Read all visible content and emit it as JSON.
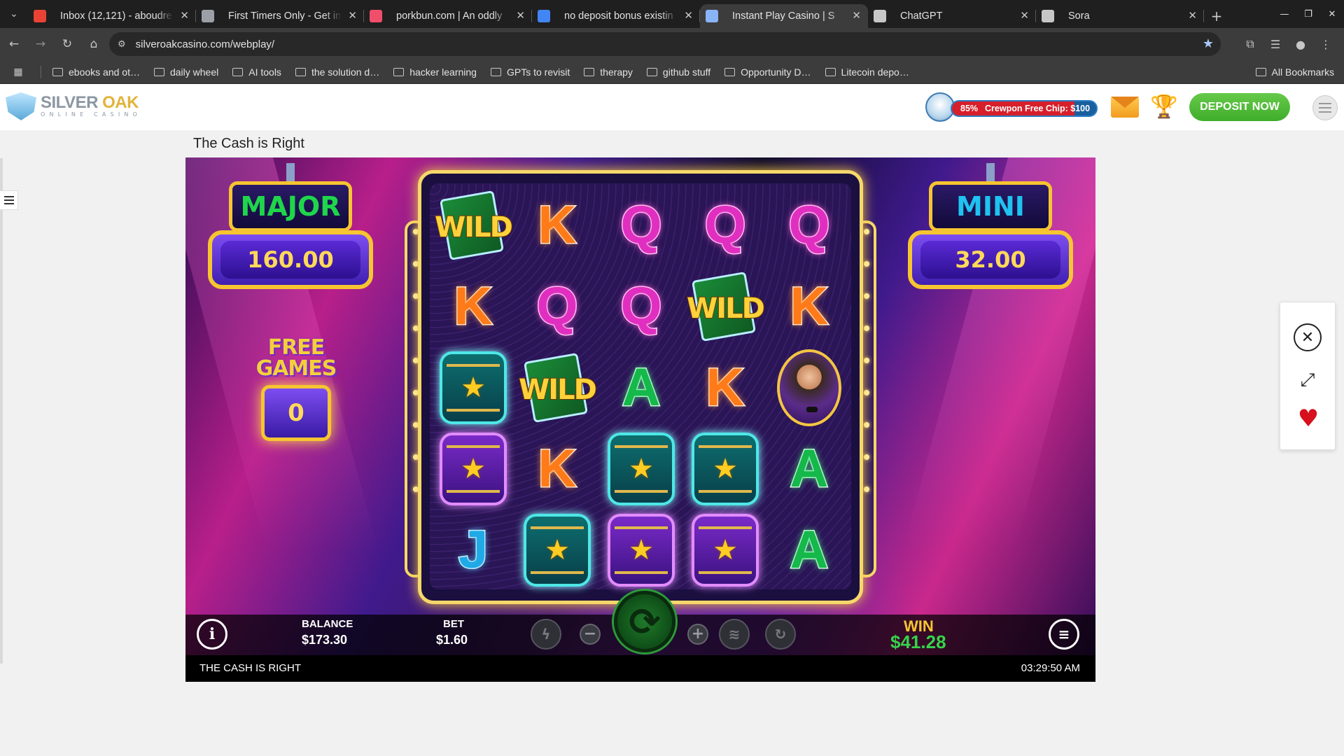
{
  "browser": {
    "tabs": [
      {
        "title": "Inbox (12,121) - aboudre",
        "favicon_color": "#ea4335",
        "active": false
      },
      {
        "title": "First Timers Only - Get im",
        "favicon_color": "#9aa0a6",
        "active": false
      },
      {
        "title": "porkbun.com | An oddly",
        "favicon_color": "#ef4f6b",
        "active": false
      },
      {
        "title": "no deposit bonus existin",
        "favicon_color": "#4285f4",
        "active": false
      },
      {
        "title": "Instant Play Casino | S",
        "favicon_color": "#8ab4f8",
        "active": true
      },
      {
        "title": "ChatGPT",
        "favicon_color": "#c7c7c7",
        "active": false
      },
      {
        "title": "Sora",
        "favicon_color": "#c7c7c7",
        "active": false
      }
    ],
    "url": "silveroakcasino.com/webplay/",
    "bookmarks": [
      "ebooks and ot…",
      "daily wheel",
      "AI tools",
      "the solution d…",
      "hacker learning",
      "GPTs to revisit",
      "therapy",
      "github stuff",
      "Opportunity D…",
      "Litecoin depo…"
    ],
    "all_bookmarks": "All Bookmarks"
  },
  "site": {
    "logo_word1": "SILVER",
    "logo_word2": "OAK",
    "logo_sub": "ONLINE CASINO",
    "promo_percent": "85%",
    "promo_text": "Crewpon Free Chip: $100",
    "deposit_label": "DEPOSIT NOW",
    "game_title": "The Cash is Right"
  },
  "game": {
    "jackpot_major_label": "MAJOR",
    "jackpot_major_value": "160.00",
    "jackpot_mini_label": "MINI",
    "jackpot_mini_value": "32.00",
    "free_games_label_1": "FREE",
    "free_games_label_2": "GAMES",
    "free_games_count": "0",
    "grid": [
      [
        "WILD",
        "K",
        "Q",
        "Q",
        "Q"
      ],
      [
        "K",
        "Q",
        "Q",
        "WILD",
        "K"
      ],
      [
        "BARREL_TEAL",
        "WILD",
        "A",
        "K",
        "HOST"
      ],
      [
        "BARREL_PURPLE",
        "K",
        "BARREL_TEAL",
        "BARREL_TEAL",
        "A"
      ],
      [
        "J",
        "BARREL_TEAL",
        "BARREL_PURPLE",
        "BARREL_PURPLE",
        "A"
      ]
    ],
    "balance_label": "BALANCE",
    "balance_value": "$173.30",
    "bet_label": "BET",
    "bet_value": "$1.60",
    "win_label": "WIN",
    "win_value": "$41.28",
    "info_icon": "i",
    "game_name": "THE CASH IS RIGHT",
    "clock": "03:29:50 AM"
  },
  "colors": {
    "deposit_green": "#4cb935",
    "win_green": "#37d24b",
    "jackpot_gold": "#f6c531",
    "major_text": "#1fd64a",
    "mini_text": "#1fc2f0"
  }
}
